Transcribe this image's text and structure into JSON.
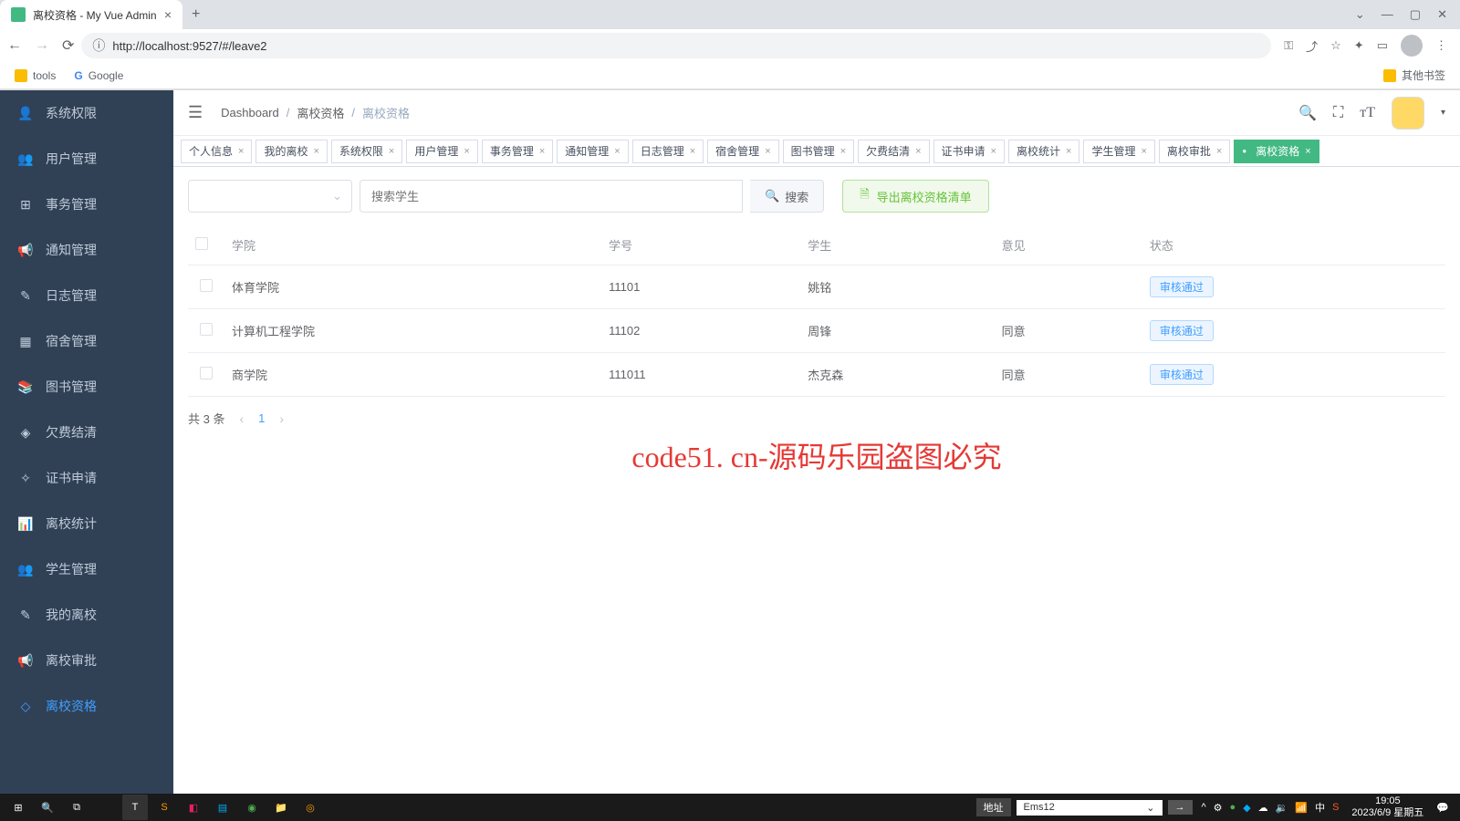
{
  "browser": {
    "tab_title": "离校资格 - My Vue Admin",
    "url": "http://localhost:9527/#/leave2",
    "bookmarks": {
      "tools": "tools",
      "google": "Google",
      "other": "其他书签"
    }
  },
  "sidebar": {
    "items": [
      {
        "label": "系统权限",
        "icon": "user"
      },
      {
        "label": "用户管理",
        "icon": "users"
      },
      {
        "label": "事务管理",
        "icon": "tasks"
      },
      {
        "label": "通知管理",
        "icon": "bell"
      },
      {
        "label": "日志管理",
        "icon": "log"
      },
      {
        "label": "宿舍管理",
        "icon": "home"
      },
      {
        "label": "图书管理",
        "icon": "book"
      },
      {
        "label": "欠费结清",
        "icon": "money"
      },
      {
        "label": "证书申请",
        "icon": "cert"
      },
      {
        "label": "离校统计",
        "icon": "chart"
      },
      {
        "label": "学生管理",
        "icon": "student"
      },
      {
        "label": "我的离校",
        "icon": "edit"
      },
      {
        "label": "离校审批",
        "icon": "approve"
      },
      {
        "label": "离校资格",
        "icon": "qualify",
        "active": true
      }
    ]
  },
  "breadcrumb": {
    "root": "Dashboard",
    "mid": "离校资格",
    "current": "离校资格"
  },
  "tabs": [
    {
      "label": "个人信息"
    },
    {
      "label": "我的离校"
    },
    {
      "label": "系统权限"
    },
    {
      "label": "用户管理"
    },
    {
      "label": "事务管理"
    },
    {
      "label": "通知管理"
    },
    {
      "label": "日志管理"
    },
    {
      "label": "宿舍管理"
    },
    {
      "label": "图书管理"
    },
    {
      "label": "欠费结清"
    },
    {
      "label": "证书申请"
    },
    {
      "label": "离校统计"
    },
    {
      "label": "学生管理"
    },
    {
      "label": "离校审批"
    },
    {
      "label": "离校资格",
      "active": true
    }
  ],
  "filters": {
    "search_placeholder": "搜索学生",
    "search_btn": "搜索",
    "export_btn": "导出离校资格清单"
  },
  "table": {
    "headers": {
      "college": "学院",
      "number": "学号",
      "student": "学生",
      "opinion": "意见",
      "status": "状态"
    },
    "rows": [
      {
        "college": "体育学院",
        "number": "11101",
        "student": "姚铭",
        "opinion": "",
        "status": "审核通过"
      },
      {
        "college": "计算机工程学院",
        "number": "11102",
        "student": "周锋",
        "opinion": "同意",
        "status": "审核通过"
      },
      {
        "college": "商学院",
        "number": "111011",
        "student": "杰克森",
        "opinion": "同意",
        "status": "审核通过"
      }
    ]
  },
  "pagination": {
    "total_text": "共 3 条",
    "current": "1"
  },
  "watermark": "code51. cn-源码乐园盗图必究",
  "taskbar": {
    "addr_label": "地址",
    "addr_value": "Ems12",
    "time": "19:05",
    "date": "2023/6/9 星期五"
  }
}
